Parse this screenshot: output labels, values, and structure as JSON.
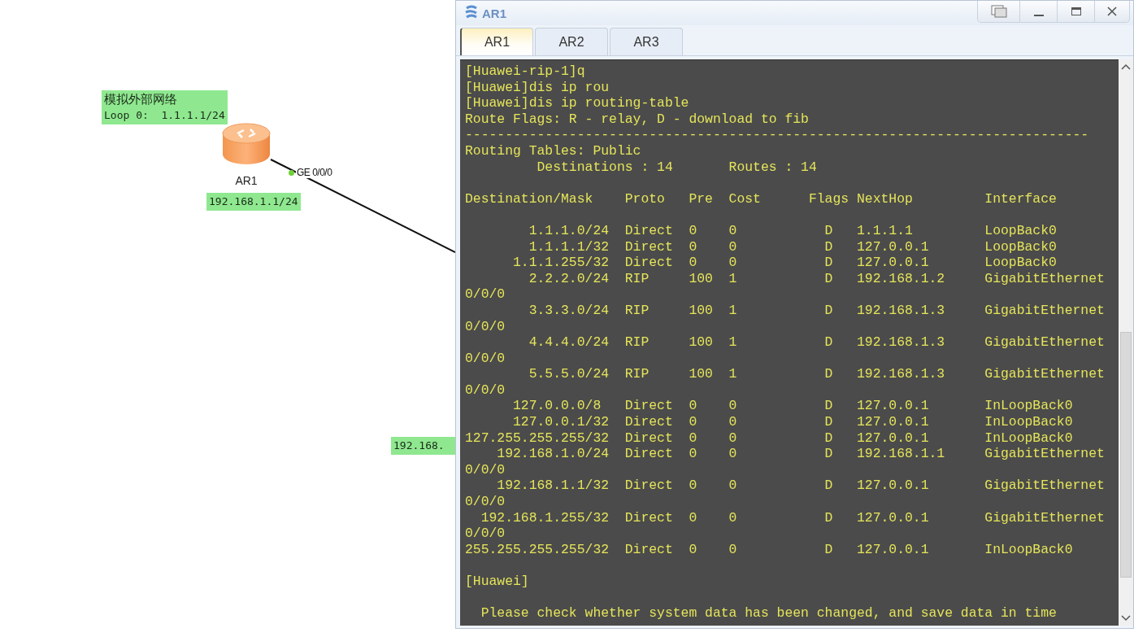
{
  "topology": {
    "devices": [
      {
        "kind": "router",
        "name": "AR1"
      }
    ],
    "ports": [
      {
        "label": "GE 0/0/0"
      }
    ],
    "notes": [
      {
        "lines": [
          "模拟外部网络",
          "Loop 0:  1.1.1.1/24"
        ]
      },
      {
        "lines": [
          "192.168.1.1/24"
        ]
      },
      {
        "lines": [
          "192.168."
        ]
      }
    ]
  },
  "window": {
    "title": "AR1"
  },
  "tabs": [
    {
      "label": "AR1",
      "selected": true
    },
    {
      "label": "AR2",
      "selected": false
    },
    {
      "label": "AR3",
      "selected": false
    }
  ],
  "terminal": {
    "blocks": [
      [
        "[Huawei-rip-1]q",
        "[Huawei]dis ip rou",
        "[Huawei]dis ip routing-table",
        "Route Flags: R - relay, D - download to fib",
        "------------------------------------------------------------------------------",
        "Routing Tables: Public",
        "         Destinations : 14       Routes : 14"
      ],
      [
        "Destination/Mask    Proto   Pre  Cost      Flags NextHop         Interface"
      ],
      [
        "        1.1.1.0/24  Direct  0    0           D   1.1.1.1         LoopBack0",
        "        1.1.1.1/32  Direct  0    0           D   127.0.0.1       LoopBack0",
        "      1.1.1.255/32  Direct  0    0           D   127.0.0.1       LoopBack0",
        "        2.2.2.0/24  RIP     100  1           D   192.168.1.2     GigabitEthernet",
        "0/0/0",
        "        3.3.3.0/24  RIP     100  1           D   192.168.1.3     GigabitEthernet",
        "0/0/0",
        "        4.4.4.0/24  RIP     100  1           D   192.168.1.3     GigabitEthernet",
        "0/0/0",
        "        5.5.5.0/24  RIP     100  1           D   192.168.1.3     GigabitEthernet",
        "0/0/0",
        "      127.0.0.0/8   Direct  0    0           D   127.0.0.1       InLoopBack0",
        "      127.0.0.1/32  Direct  0    0           D   127.0.0.1       InLoopBack0",
        "127.255.255.255/32  Direct  0    0           D   127.0.0.1       InLoopBack0",
        "    192.168.1.0/24  Direct  0    0           D   192.168.1.1     GigabitEthernet",
        "0/0/0",
        "    192.168.1.1/32  Direct  0    0           D   127.0.0.1       GigabitEthernet",
        "0/0/0",
        "  192.168.1.255/32  Direct  0    0           D   127.0.0.1       GigabitEthernet",
        "0/0/0",
        "255.255.255.255/32  Direct  0    0           D   127.0.0.1       InLoopBack0"
      ],
      [
        "[Huawei]"
      ],
      [
        "  Please check whether system data has been changed, and save data in time"
      ]
    ]
  }
}
